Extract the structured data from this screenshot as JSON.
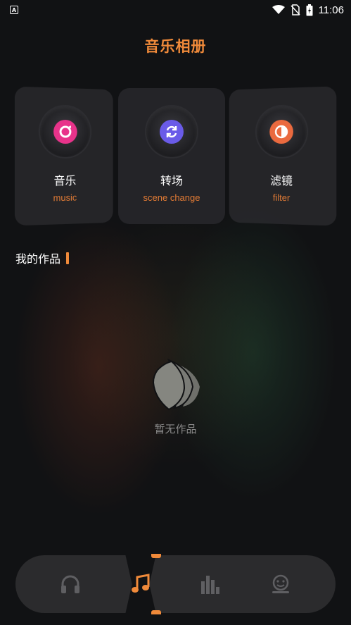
{
  "status_bar": {
    "time": "11:06",
    "left_icon": "A"
  },
  "app": {
    "title": "音乐相册"
  },
  "cards": [
    {
      "title": "音乐",
      "subtitle": "music",
      "icon": "music-disc-icon",
      "color": "#e8338a"
    },
    {
      "title": "转场",
      "subtitle": "scene change",
      "icon": "refresh-icon",
      "color": "#6a5be8"
    },
    {
      "title": "滤镜",
      "subtitle": "filter",
      "icon": "filter-icon",
      "color": "#ea6a3f"
    }
  ],
  "section": {
    "title": "我的作品"
  },
  "empty_state": {
    "text": "暂无作品",
    "icon": "book-pages-icon"
  },
  "tabs": [
    {
      "icon": "headphones-icon",
      "active": false
    },
    {
      "icon": "music-note-icon",
      "active": true
    },
    {
      "icon": "equalizer-icon",
      "active": false
    },
    {
      "icon": "profile-icon",
      "active": false
    }
  ],
  "colors": {
    "accent": "#f08a3a",
    "background": "#111214",
    "card": "#28282c",
    "tab_bar": "#2b2b2d"
  }
}
